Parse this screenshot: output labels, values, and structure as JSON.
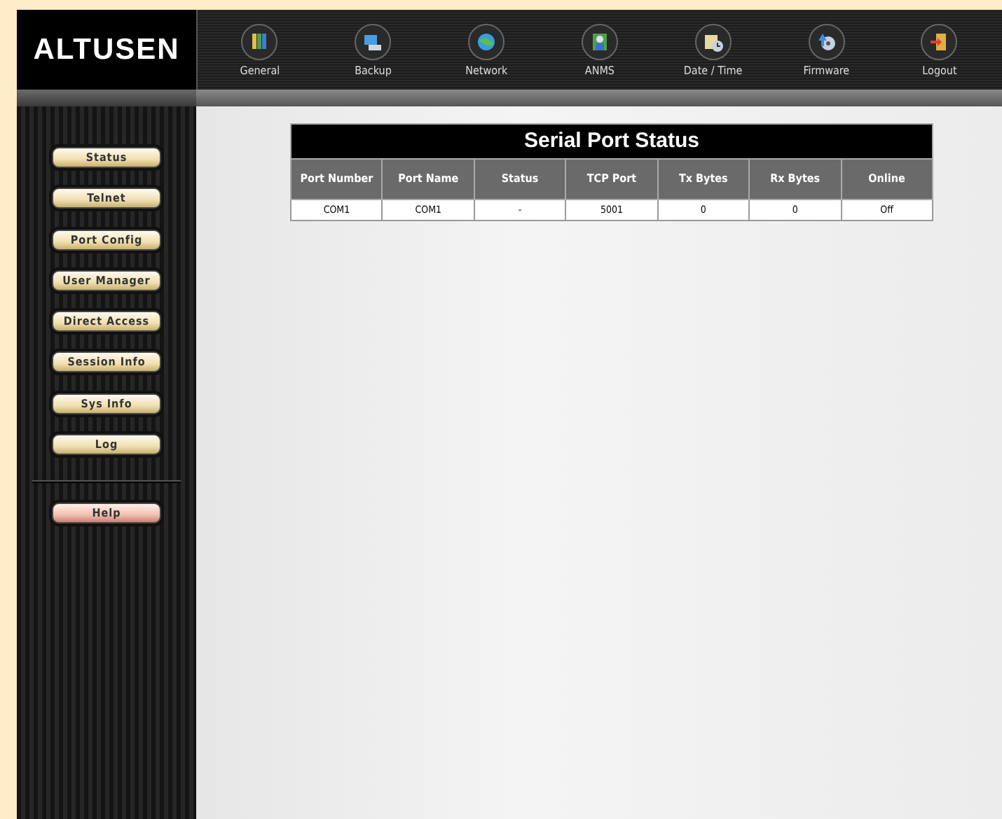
{
  "logo": "ALTUSEN",
  "toolbar": [
    {
      "label": "General"
    },
    {
      "label": "Backup"
    },
    {
      "label": "Network"
    },
    {
      "label": "ANMS"
    },
    {
      "label": "Date / Time"
    },
    {
      "label": "Firmware"
    },
    {
      "label": "Logout"
    }
  ],
  "sidebar": {
    "items": [
      {
        "label": "Status",
        "kind": "menu"
      },
      {
        "label": "Telnet",
        "kind": "menu"
      },
      {
        "label": "Port Config",
        "kind": "menu"
      },
      {
        "label": "User Manager",
        "kind": "menu"
      },
      {
        "label": "Direct Access",
        "kind": "menu"
      },
      {
        "label": "Session Info",
        "kind": "menu"
      },
      {
        "label": "Sys Info",
        "kind": "menu"
      },
      {
        "label": "Log",
        "kind": "menu"
      },
      {
        "label": "Help",
        "kind": "help"
      }
    ]
  },
  "table": {
    "title": "Serial Port Status",
    "columns": [
      "Port Number",
      "Port Name",
      "Status",
      "TCP Port",
      "Tx Bytes",
      "Rx Bytes",
      "Online"
    ],
    "rows": [
      [
        "COM1",
        "COM1",
        "-",
        "5001",
        "0",
        "0",
        "Off"
      ]
    ]
  }
}
